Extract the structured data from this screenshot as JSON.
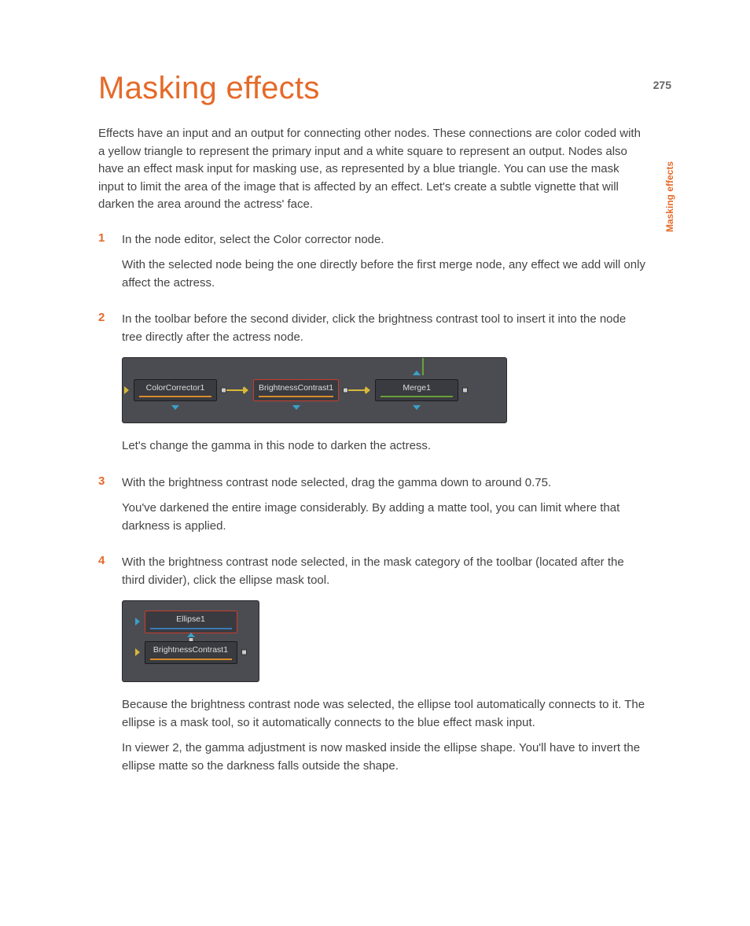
{
  "page_number": "275",
  "side_label": "Masking effects",
  "title": "Masking effects",
  "intro": "Effects have an input and an output for connecting other nodes. These connections are color coded with a yellow triangle to represent the primary input and a white square to represent an output. Nodes also have an effect mask input  for masking use, as represented by a blue triangle. You can use the mask input to limit the area of the image that is affected by an effect. Let's create a subtle vignette that will darken the area around the actress' face.",
  "steps": {
    "s1": {
      "num": "1",
      "p1": "In the node editor, select the Color corrector node.",
      "p2": "With the selected node being the one directly before the first merge node, any effect we add will only affect the actress."
    },
    "s2": {
      "num": "2",
      "p1": "In the toolbar before the second divider, click the brightness contrast tool to insert it into the node tree directly after the actress node.",
      "after": "Let's change the gamma in this node to darken the actress."
    },
    "s3": {
      "num": "3",
      "p1": "With the brightness contrast node selected, drag the gamma down to around 0.75.",
      "p2": "You've darkened the entire image considerably. By adding a matte tool, you can limit where that darkness is applied."
    },
    "s4": {
      "num": "4",
      "p1": "With the brightness contrast node selected, in the mask category of the toolbar (located after the third divider), click the ellipse mask tool.",
      "p2": "Because the brightness contrast node was selected, the ellipse tool automatically connects to it. The ellipse is a mask tool, so it automatically connects to the blue effect mask input.",
      "p3": "In viewer 2, the gamma adjustment is now masked inside the ellipse shape. You'll have to invert the ellipse matte so the darkness falls outside the shape."
    }
  },
  "diagram1": {
    "n1": "ColorCorrector1",
    "n2": "BrightnessContrast1",
    "n3": "Merge1"
  },
  "diagram2": {
    "n1": "Ellipse1",
    "n2": "BrightnessContrast1"
  }
}
